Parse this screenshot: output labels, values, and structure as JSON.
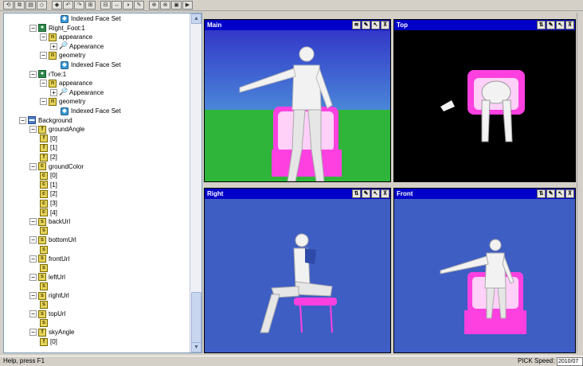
{
  "toolbar": {
    "buttons": [
      "⟲",
      "⧉",
      "▤",
      "◇",
      "◆",
      "↶",
      "↷",
      "⊞",
      "⊟",
      "↔",
      "◑",
      "✎",
      "⊕",
      "⊗",
      "▣",
      "▶"
    ]
  },
  "tree": {
    "nodes": [
      {
        "label": "Indexed Face Set",
        "icon": "face",
        "glyph": "◆",
        "exp": "",
        "indent": 5
      },
      {
        "label": "Right_Foot:1",
        "icon": "shape",
        "glyph": "●",
        "exp": "−",
        "indent": 2
      },
      {
        "label": "appearance",
        "icon": "field",
        "glyph": "n",
        "exp": "−",
        "indent": 3
      },
      {
        "label": "Appearance",
        "icon": "appr",
        "glyph": "🔎",
        "exp": "+",
        "indent": 4
      },
      {
        "label": "geometry",
        "icon": "field",
        "glyph": "n",
        "exp": "−",
        "indent": 3
      },
      {
        "label": "Indexed Face Set",
        "icon": "face",
        "glyph": "◆",
        "exp": "",
        "indent": 5
      },
      {
        "label": "rToe:1",
        "icon": "shape",
        "glyph": "●",
        "exp": "−",
        "indent": 2
      },
      {
        "label": "appearance",
        "icon": "field",
        "glyph": "n",
        "exp": "−",
        "indent": 3
      },
      {
        "label": "Appearance",
        "icon": "appr",
        "glyph": "🔎",
        "exp": "+",
        "indent": 4
      },
      {
        "label": "geometry",
        "icon": "field",
        "glyph": "n",
        "exp": "−",
        "indent": 3
      },
      {
        "label": "Indexed Face Set",
        "icon": "face",
        "glyph": "◆",
        "exp": "",
        "indent": 5
      },
      {
        "label": "Background",
        "icon": "bg",
        "glyph": "▬",
        "exp": "−",
        "indent": 1
      },
      {
        "label": "groundAngle",
        "icon": "field",
        "glyph": "f",
        "exp": "−",
        "indent": 2
      },
      {
        "label": "[0]",
        "icon": "field",
        "glyph": "f",
        "exp": "",
        "indent": 3
      },
      {
        "label": "[1]",
        "icon": "field",
        "glyph": "f",
        "exp": "",
        "indent": 3
      },
      {
        "label": "[2]",
        "icon": "field",
        "glyph": "f",
        "exp": "",
        "indent": 3
      },
      {
        "label": "groundColor",
        "icon": "field",
        "glyph": "c",
        "exp": "−",
        "indent": 2
      },
      {
        "label": "[0]",
        "icon": "field",
        "glyph": "c",
        "exp": "",
        "indent": 3
      },
      {
        "label": "[1]",
        "icon": "field",
        "glyph": "c",
        "exp": "",
        "indent": 3
      },
      {
        "label": "[2]",
        "icon": "field",
        "glyph": "c",
        "exp": "",
        "indent": 3
      },
      {
        "label": "[3]",
        "icon": "field",
        "glyph": "c",
        "exp": "",
        "indent": 3
      },
      {
        "label": "[4]",
        "icon": "field",
        "glyph": "c",
        "exp": "",
        "indent": 3
      },
      {
        "label": "backUrl",
        "icon": "field",
        "glyph": "s",
        "exp": "−",
        "indent": 2
      },
      {
        "label": "",
        "icon": "field",
        "glyph": "s",
        "exp": "",
        "indent": 3
      },
      {
        "label": "bottomUrl",
        "icon": "field",
        "glyph": "s",
        "exp": "−",
        "indent": 2
      },
      {
        "label": "",
        "icon": "field",
        "glyph": "s",
        "exp": "",
        "indent": 3
      },
      {
        "label": "frontUrl",
        "icon": "field",
        "glyph": "s",
        "exp": "−",
        "indent": 2
      },
      {
        "label": "",
        "icon": "field",
        "glyph": "s",
        "exp": "",
        "indent": 3
      },
      {
        "label": "leftUrl",
        "icon": "field",
        "glyph": "s",
        "exp": "−",
        "indent": 2
      },
      {
        "label": "",
        "icon": "field",
        "glyph": "s",
        "exp": "",
        "indent": 3
      },
      {
        "label": "rightUrl",
        "icon": "field",
        "glyph": "s",
        "exp": "−",
        "indent": 2
      },
      {
        "label": "",
        "icon": "field",
        "glyph": "s",
        "exp": "",
        "indent": 3
      },
      {
        "label": "topUrl",
        "icon": "field",
        "glyph": "s",
        "exp": "−",
        "indent": 2
      },
      {
        "label": "",
        "icon": "field",
        "glyph": "s",
        "exp": "",
        "indent": 3
      },
      {
        "label": "skyAngle",
        "icon": "field",
        "glyph": "f",
        "exp": "−",
        "indent": 2
      },
      {
        "label": "[0]",
        "icon": "field",
        "glyph": "f",
        "exp": "",
        "indent": 3
      }
    ]
  },
  "views": [
    {
      "title": "Main",
      "tools": [
        "≋",
        "✎",
        "↖",
        "⊼"
      ],
      "bg_top": "#3b4fd0",
      "bg_bottom": "#2fb53a"
    },
    {
      "title": "Top",
      "tools": [
        "⇅",
        "✎",
        "↖",
        "⊼"
      ],
      "bg_top": "#000000",
      "bg_bottom": "#000000"
    },
    {
      "title": "Right",
      "tools": [
        "⇅",
        "✎",
        "↖",
        "⊼"
      ],
      "bg_top": "#3e5ec4",
      "bg_bottom": "#3e5ec4"
    },
    {
      "title": "Front",
      "tools": [
        "⇅",
        "✎",
        "↖",
        "⊼"
      ],
      "bg_top": "#3e5ec4",
      "bg_bottom": "#3e5ec4"
    }
  ],
  "status": {
    "help": "Help, press F1",
    "mode": "PICK",
    "speed_label": "Speed:",
    "speed_value": "2010/07"
  },
  "colors": {
    "view_header": "#0000c8",
    "chair_pink": "#ff40e0",
    "figure_white": "#f2f2f2"
  }
}
